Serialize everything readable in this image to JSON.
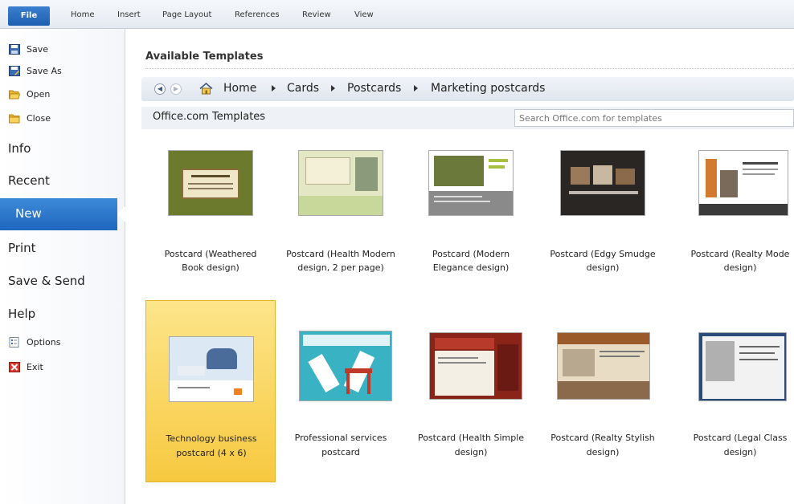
{
  "ribbon": {
    "tabs": [
      "File",
      "Home",
      "Insert",
      "Page Layout",
      "References",
      "Review",
      "View"
    ]
  },
  "sidebar": {
    "top_items": [
      "Save",
      "Save As",
      "Open",
      "Close"
    ],
    "info": "Info",
    "recent": "Recent",
    "new": "New",
    "print": "Print",
    "save_send": "Save & Send",
    "help": "Help",
    "options": "Options",
    "exit": "Exit"
  },
  "main": {
    "title": "Available Templates",
    "breadcrumb": [
      "Home",
      "Cards",
      "Postcards",
      "Marketing postcards"
    ],
    "section_title": "Office.com Templates",
    "search_placeholder": "Search Office.com for templates"
  },
  "templates": [
    {
      "l1": "Postcard (Weathered",
      "l2": "Book design)"
    },
    {
      "l1": "Postcard (Health Modern",
      "l2": "design, 2 per page)"
    },
    {
      "l1": "Postcard (Modern",
      "l2": "Elegance design)"
    },
    {
      "l1": "Postcard (Edgy Smudge",
      "l2": "design)"
    },
    {
      "l1": "Postcard (Realty Mode",
      "l2": "design)"
    },
    {
      "l1": "Technology business",
      "l2": "postcard (4 x 6)"
    },
    {
      "l1": "Professional services",
      "l2": "postcard"
    },
    {
      "l1": "Postcard (Health Simple",
      "l2": "design)"
    },
    {
      "l1": "Postcard (Realty Stylish",
      "l2": "design)"
    },
    {
      "l1": "Postcard (Legal Class",
      "l2": "design)"
    }
  ],
  "colors": {
    "accent": "#1f66bf",
    "selection": "#f7c940"
  }
}
